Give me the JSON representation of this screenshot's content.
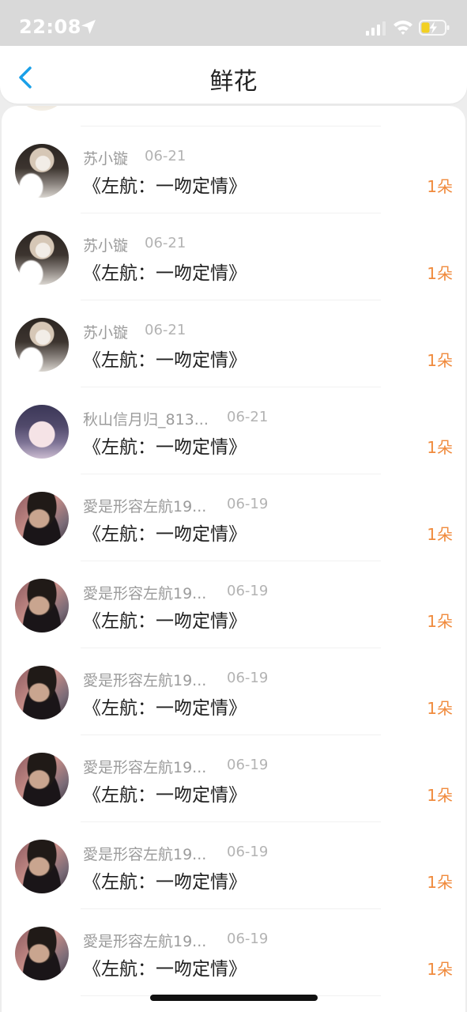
{
  "status_bar": {
    "time": "22:08",
    "icons": [
      "location-arrow-icon",
      "cellular-signal-icon",
      "wifi-icon",
      "battery-charging-icon"
    ]
  },
  "header": {
    "title": "鲜花",
    "back_icon": "chevron-left-icon"
  },
  "colors": {
    "accent_back": "#1aa0e8",
    "count_orange": "#f08a3c",
    "name_gray": "#9b9b9b",
    "date_gray": "#b3b3b3",
    "text_dark": "#1f1f1f"
  },
  "items": [
    {
      "name": "苏小镟",
      "date": "06-21",
      "book": "《左航：一吻定情》",
      "count": "1朵",
      "avatar": "avatar-girl-mask"
    },
    {
      "name": "苏小镟",
      "date": "06-21",
      "book": "《左航：一吻定情》",
      "count": "1朵",
      "avatar": "avatar-girl-mask"
    },
    {
      "name": "苏小镟",
      "date": "06-21",
      "book": "《左航：一吻定情》",
      "count": "1朵",
      "avatar": "avatar-girl-mask"
    },
    {
      "name": "秋山信月归_813...",
      "date": "06-21",
      "book": "《左航：一吻定情》",
      "count": "1朵",
      "avatar": "avatar-anime"
    },
    {
      "name": "愛是形容左航19...",
      "date": "06-19",
      "book": "《左航：一吻定情》",
      "count": "1朵",
      "avatar": "avatar-boy"
    },
    {
      "name": "愛是形容左航19...",
      "date": "06-19",
      "book": "《左航：一吻定情》",
      "count": "1朵",
      "avatar": "avatar-boy"
    },
    {
      "name": "愛是形容左航19...",
      "date": "06-19",
      "book": "《左航：一吻定情》",
      "count": "1朵",
      "avatar": "avatar-boy"
    },
    {
      "name": "愛是形容左航19...",
      "date": "06-19",
      "book": "《左航：一吻定情》",
      "count": "1朵",
      "avatar": "avatar-boy"
    },
    {
      "name": "愛是形容左航19...",
      "date": "06-19",
      "book": "《左航：一吻定情》",
      "count": "1朵",
      "avatar": "avatar-boy"
    },
    {
      "name": "愛是形容左航19...",
      "date": "06-19",
      "book": "《左航：一吻定情》",
      "count": "1朵",
      "avatar": "avatar-boy"
    }
  ]
}
